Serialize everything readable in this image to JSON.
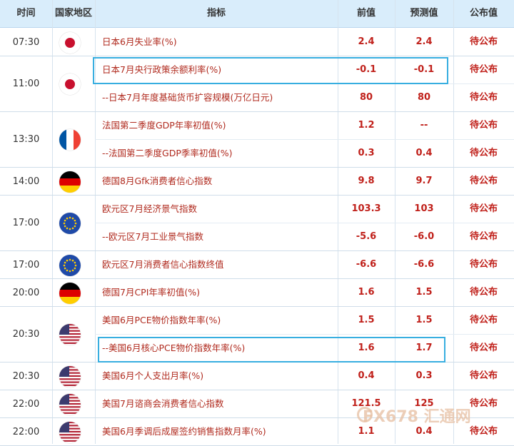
{
  "header": {
    "time": "时间",
    "region": "国家地区",
    "indicator": "指标",
    "previous": "前值",
    "forecast": "预测值",
    "published": "公布值"
  },
  "rows": [
    {
      "time": "07:30",
      "flag": "japan",
      "indicator": "日本6月失业率(%)",
      "previous": "2.4",
      "forecast": "2.4",
      "published": "待公布"
    },
    {
      "time": "11:00",
      "flag": "japan",
      "indicator": "日本7月央行政策余额利率(%)",
      "previous": "-0.1",
      "forecast": "-0.1",
      "published": "待公布"
    },
    {
      "time": "",
      "flag": "",
      "indicator": "--日本7月年度基础货币扩容规模(万亿日元)",
      "previous": "80",
      "forecast": "80",
      "published": "待公布"
    },
    {
      "time": "13:30",
      "flag": "france",
      "indicator": "法国第二季度GDP年率初值(%)",
      "previous": "1.2",
      "forecast": "--",
      "published": "待公布"
    },
    {
      "time": "",
      "flag": "",
      "indicator": "--法国第二季度GDP季率初值(%)",
      "previous": "0.3",
      "forecast": "0.4",
      "published": "待公布"
    },
    {
      "time": "14:00",
      "flag": "germany",
      "indicator": "德国8月Gfk消费者信心指数",
      "previous": "9.8",
      "forecast": "9.7",
      "published": "待公布"
    },
    {
      "time": "17:00",
      "flag": "eu",
      "indicator": "欧元区7月经济景气指数",
      "previous": "103.3",
      "forecast": "103",
      "published": "待公布"
    },
    {
      "time": "",
      "flag": "",
      "indicator": "--欧元区7月工业景气指数",
      "previous": "-5.6",
      "forecast": "-6.0",
      "published": "待公布"
    },
    {
      "time": "17:00",
      "flag": "eu",
      "indicator": "欧元区7月消费者信心指数终值",
      "previous": "-6.6",
      "forecast": "-6.6",
      "published": "待公布"
    },
    {
      "time": "20:00",
      "flag": "germany",
      "indicator": "德国7月CPI年率初值(%)",
      "previous": "1.6",
      "forecast": "1.5",
      "published": "待公布"
    },
    {
      "time": "20:30",
      "flag": "usa",
      "indicator": "美国6月PCE物价指数年率(%)",
      "previous": "1.5",
      "forecast": "1.5",
      "published": "待公布"
    },
    {
      "time": "",
      "flag": "",
      "indicator": "--美国6月核心PCE物价指数年率(%)",
      "previous": "1.6",
      "forecast": "1.7",
      "published": "待公布"
    },
    {
      "time": "20:30",
      "flag": "usa",
      "indicator": "美国6月个人支出月率(%)",
      "previous": "0.4",
      "forecast": "0.3",
      "published": "待公布"
    },
    {
      "time": "22:00",
      "flag": "usa",
      "indicator": "美国7月谘商会消费者信心指数",
      "previous": "121.5",
      "forecast": "125",
      "published": "待公布"
    },
    {
      "time": "22:00",
      "flag": "usa",
      "indicator": "美国6月季调后成屋签约销售指数月率(%)",
      "previous": "1.1",
      "forecast": "0.4",
      "published": "待公布"
    }
  ],
  "watermark": "FX678 汇通网",
  "colors": {
    "header_bg": "#d9edfb",
    "indicator_text": "#b02a1e",
    "value_text": "#c0201a",
    "highlight": "#37aee0"
  }
}
